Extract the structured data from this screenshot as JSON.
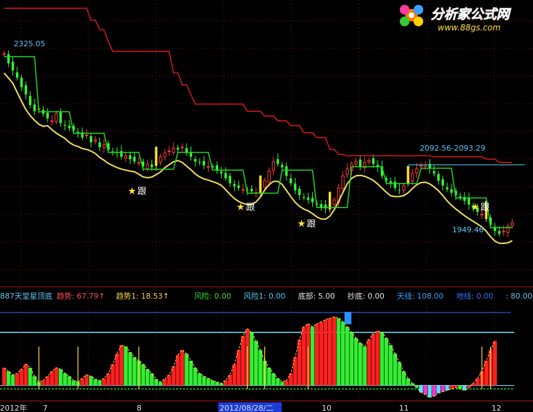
{
  "watermark": {
    "site_name": "分析家公式网",
    "url": "www.88gs.com"
  },
  "chart_data": [
    {
      "type": "candlestick",
      "title": "",
      "price_labels": {
        "high": "2325.05",
        "range": "2092.56-2093.29",
        "low": "1949.46"
      },
      "signals": [
        {
          "symbol": "★",
          "label": "跟",
          "bar": 31
        },
        {
          "symbol": "★",
          "label": "跟",
          "bar": 56
        },
        {
          "symbol": "★",
          "label": "跟",
          "bar": 70
        },
        {
          "symbol": "★",
          "label": "跟",
          "bar": 110
        }
      ],
      "colors": {
        "up": "#ff3b3b",
        "down": "#33ff33",
        "signal_bar": "#ffe23a",
        "resistance": "#d01818",
        "support": "#f2e35a",
        "step_line": "#22d822",
        "price_line": "#5bc8f5"
      },
      "series": [
        {
          "values": [
            2325,
            2305,
            2290,
            2275,
            2255,
            2240,
            2218,
            2205,
            2210,
            2200,
            2190,
            2185,
            2200,
            2180,
            2175,
            2170,
            2165,
            2160,
            2150,
            2155,
            2140,
            2145,
            2130,
            2135,
            2125,
            2120,
            2118,
            2110,
            2112,
            2105,
            2100,
            2098,
            2090,
            2095,
            2088,
            2102,
            2110,
            2118,
            2122,
            2128,
            2125,
            2130,
            2118,
            2110,
            2100,
            2098,
            2092,
            2090,
            2088,
            2082,
            2075,
            2065,
            2055,
            2048,
            2045,
            2042,
            2040,
            2038,
            2035,
            2042,
            2060,
            2080,
            2100,
            2095,
            2088,
            2070,
            2055,
            2040,
            2030,
            2025,
            2020,
            2015,
            2010,
            2005,
            2002,
            2008,
            2020,
            2045,
            2070,
            2085,
            2095,
            2100,
            2090,
            2098,
            2102,
            2095,
            2088,
            2070,
            2060,
            2055,
            2045,
            2040,
            2050,
            2062,
            2075,
            2085,
            2092,
            2093,
            2085,
            2075,
            2060,
            2050,
            2042,
            2035,
            2030,
            2025,
            2018,
            2010,
            2002,
            1995,
            1990,
            1980,
            1968,
            1955,
            1949,
            1955,
            1965,
            1972
          ]
        }
      ],
      "levels": {
        "resistance": [
          2420,
          2420,
          2420,
          2420,
          2420,
          2420,
          2420,
          2420,
          2420,
          2420,
          2420,
          2420,
          2420,
          2420,
          2420,
          2420,
          2420,
          2420,
          2420,
          2420,
          2395,
          2395,
          2375,
          2375,
          2350,
          2330,
          2330,
          2330,
          2330,
          2330,
          2330,
          2330,
          2330,
          2330,
          2330,
          2330,
          2330,
          2330,
          2330,
          2285,
          2285,
          2260,
          2260,
          2240,
          2220,
          2220,
          2220,
          2220,
          2220,
          2220,
          2220,
          2220,
          2220,
          2220,
          2220,
          2220,
          2205,
          2205,
          2205,
          2205,
          2195,
          2195,
          2195,
          2185,
          2185,
          2185,
          2175,
          2175,
          2175,
          2160,
          2160,
          2160,
          2150,
          2150,
          2150,
          2125,
          2125,
          2115,
          2115,
          2112,
          2112,
          2112,
          2112,
          2112,
          2112,
          2112,
          2112,
          2112,
          2112,
          2112,
          2112,
          2112,
          2112,
          2112,
          2112,
          2112,
          2112,
          2112,
          2112,
          2110,
          2110,
          2110,
          2110,
          2110,
          2110,
          2110,
          2110,
          2110,
          2110,
          2110,
          2110,
          2105,
          2105,
          2105,
          2098,
          2098,
          2098,
          2098
        ]
      },
      "axis_labels": [
        "2012年",
        "7",
        "8",
        "2012/08/28/二",
        "10",
        "11",
        "12"
      ]
    },
    {
      "type": "indicator",
      "title": "887天堂星顶底",
      "readouts": [
        {
          "label": "趋势:",
          "value": "67.79",
          "arrow": "↑",
          "color": "#ff5050"
        },
        {
          "label": "趋势1:",
          "value": "18.53",
          "arrow": "↑",
          "color": "#ffd24a"
        },
        {
          "label": "风险:",
          "value": "0.00",
          "color": "#33dd33"
        },
        {
          "label": "风险1:",
          "value": "0.00",
          "color": "#5bc8f5"
        },
        {
          "label": "底部:",
          "value": "5.00",
          "color": "#e8e8e8"
        },
        {
          "label": "抄底:",
          "value": "0.00",
          "color": "#e8e8e8"
        },
        {
          "label": "天线:",
          "value": "108.00",
          "color": "#3aa0ff"
        },
        {
          "label": "地线:",
          "value": "0.00",
          "color": "#3a70ff"
        },
        {
          "label": ":",
          "value": "80.00",
          "color": "#5bc8f5"
        }
      ],
      "trend": [
        30,
        25,
        20,
        22,
        28,
        35,
        30,
        18,
        10,
        12,
        18,
        25,
        30,
        28,
        22,
        18,
        12,
        10,
        15,
        20,
        18,
        14,
        12,
        15,
        22,
        35,
        50,
        62,
        60,
        52,
        45,
        40,
        35,
        28,
        22,
        14,
        10,
        14,
        20,
        32,
        48,
        55,
        50,
        40,
        30,
        22,
        18,
        15,
        12,
        10,
        8,
        12,
        20,
        35,
        55,
        75,
        85,
        80,
        68,
        55,
        40,
        30,
        22,
        15,
        10,
        12,
        22,
        45,
        70,
        88,
        92,
        88,
        92,
        95,
        98,
        100,
        102,
        100,
        95,
        88,
        80,
        72,
        65,
        60,
        70,
        78,
        82,
        80,
        72,
        62,
        50,
        38,
        25,
        15,
        8,
        2,
        -5,
        -8,
        -12,
        -10,
        -6,
        -4,
        -2,
        0,
        2,
        0,
        -2,
        2,
        8,
        15,
        25,
        40,
        55,
        68
      ],
      "levels": {
        "top": 108,
        "upper": 80,
        "lower": 5
      },
      "y_range": [
        -15,
        115
      ]
    }
  ]
}
